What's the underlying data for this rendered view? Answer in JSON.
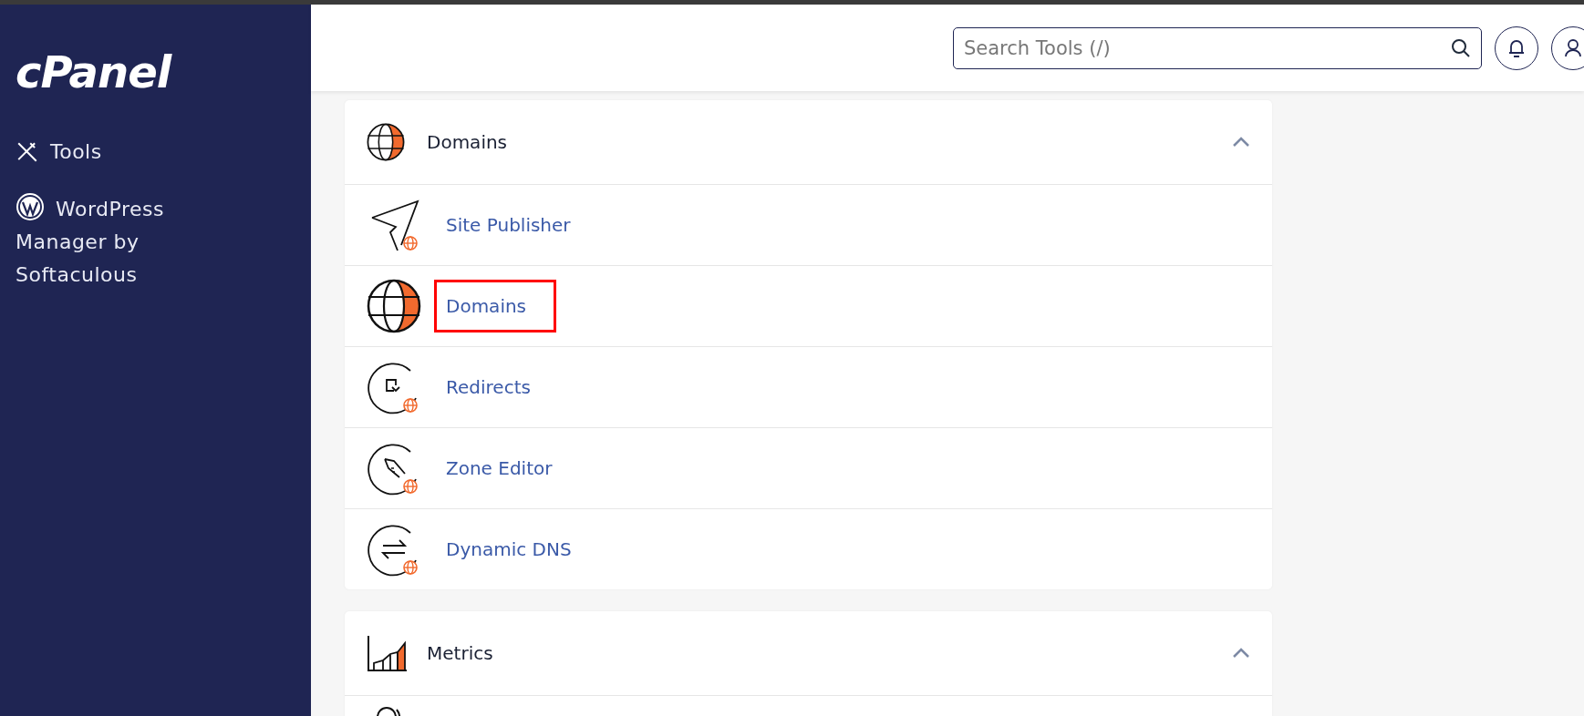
{
  "sidebar": {
    "logo": "cPanel",
    "items": [
      {
        "kind": "tools",
        "label": "Tools"
      },
      {
        "kind": "wordpress",
        "label": "WordPress Manager by Softaculous"
      }
    ]
  },
  "header": {
    "search": {
      "placeholder": "Search Tools (/)"
    }
  },
  "sections": [
    {
      "kind": "domains",
      "title": "Domains",
      "expanded": true,
      "items": [
        {
          "kind": "publisher",
          "label": "Site Publisher",
          "highlighted": false
        },
        {
          "kind": "globe",
          "label": "Domains",
          "highlighted": true
        },
        {
          "kind": "redirect",
          "label": "Redirects",
          "highlighted": false
        },
        {
          "kind": "zone",
          "label": "Zone Editor",
          "highlighted": false
        },
        {
          "kind": "dns",
          "label": "Dynamic DNS",
          "highlighted": false
        }
      ]
    },
    {
      "kind": "metrics",
      "title": "Metrics",
      "expanded": true
    }
  ]
}
